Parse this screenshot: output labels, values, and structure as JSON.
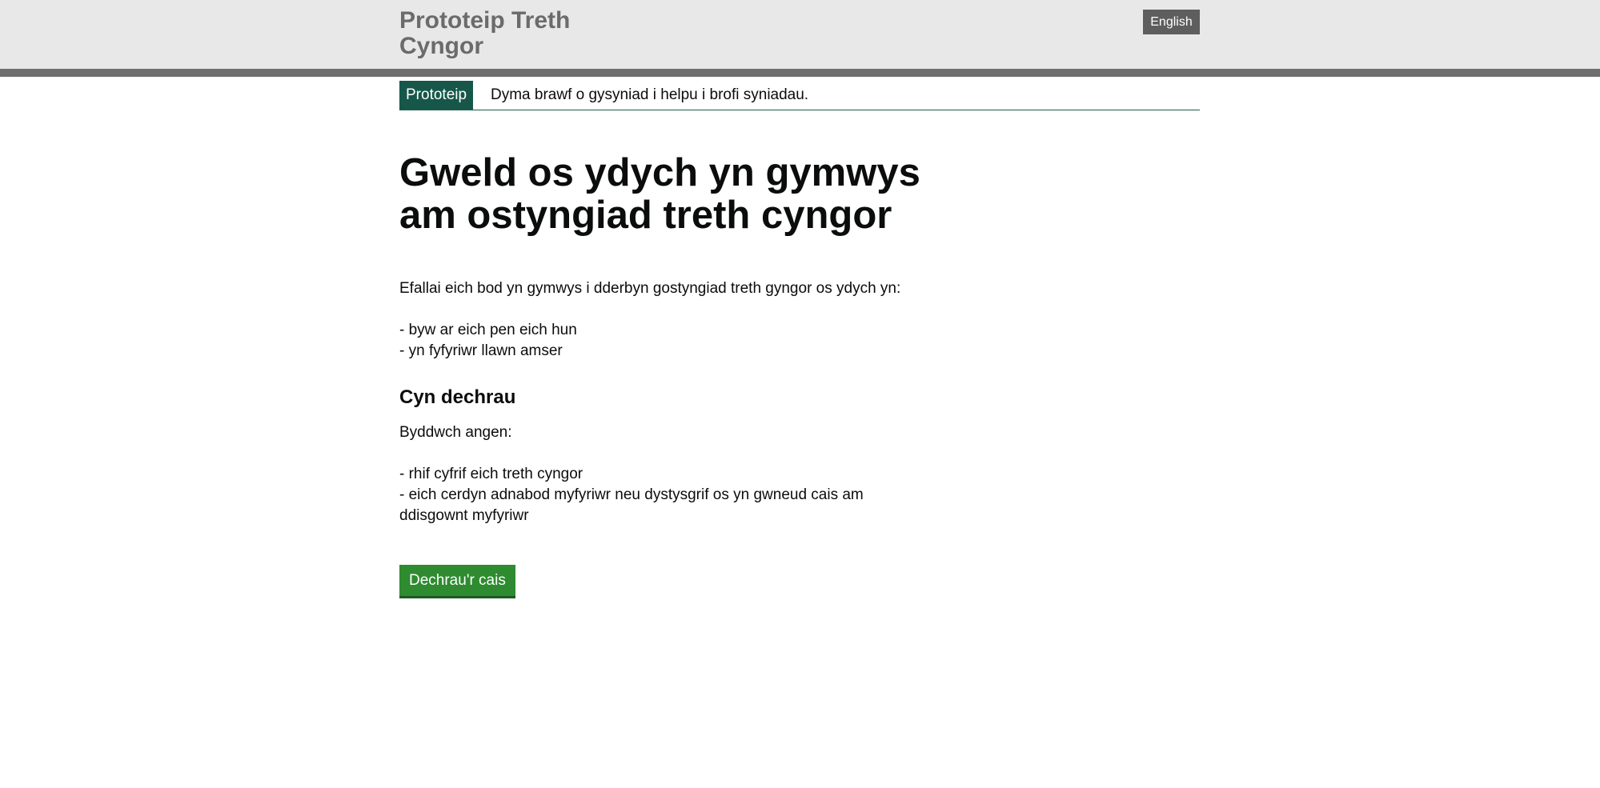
{
  "header": {
    "service_name": "Prototeip Treth Cyngor",
    "language_toggle": "English"
  },
  "phase_banner": {
    "tag": "Prototeip",
    "text": "Dyma brawf o gysyniad i helpu i brofi syniadau."
  },
  "main": {
    "title": "Gweld os ydych yn gymwys am ostyngiad treth cyngor",
    "intro": "Efallai eich bod yn gymwys i dderbyn gostyngiad treth gyngor os ydych yn:",
    "eligibility_list": [
      "- byw ar eich pen eich hun",
      "- yn fyfyriwr llawn amser"
    ],
    "section_title": "Cyn dechrau",
    "needs_intro": "Byddwch angen:",
    "needs_list": [
      "- rhif cyfrif eich treth cyngor",
      "- eich cerdyn adnabod myfyriwr neu dystysgrif os yn gwneud cais am ddisgownt myfyriwr"
    ],
    "start_button": "Dechrau'r cais"
  },
  "colors": {
    "header_bg": "#e8e8e8",
    "header_border": "#6f6f6f",
    "phase_tag_bg": "#16574a",
    "start_button_bg": "#2e8b30"
  }
}
